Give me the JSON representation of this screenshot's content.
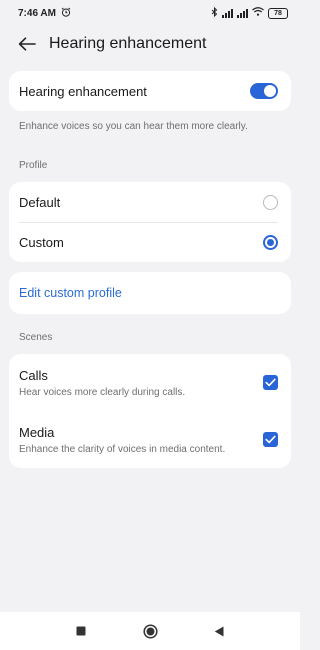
{
  "status_bar": {
    "time": "7:46 AM",
    "battery": "78",
    "icons": [
      "alarm-icon",
      "bluetooth-icon",
      "signal-icon",
      "signal-icon",
      "wifi-icon",
      "battery-icon"
    ]
  },
  "header": {
    "title": "Hearing enhancement",
    "back_icon": "back-arrow-icon"
  },
  "main_toggle": {
    "label": "Hearing enhancement",
    "enabled": true,
    "description": "Enhance voices so you can hear them more clearly."
  },
  "profile": {
    "section_label": "Profile",
    "options": [
      {
        "label": "Default",
        "selected": false
      },
      {
        "label": "Custom",
        "selected": true
      }
    ]
  },
  "edit_custom_profile": {
    "label": "Edit custom profile"
  },
  "scenes": {
    "section_label": "Scenes",
    "items": [
      {
        "title": "Calls",
        "subtitle": "Hear voices more clearly during calls.",
        "checked": true
      },
      {
        "title": "Media",
        "subtitle": "Enhance the clarity of voices in media content.",
        "checked": true
      }
    ]
  },
  "nav_bar": {
    "buttons": [
      "recents-square-icon",
      "home-circle-icon",
      "back-triangle-icon"
    ]
  },
  "colors": {
    "accent": "#2a65d8",
    "link": "#2b6bd6",
    "background": "#f2f2f5",
    "card": "#ffffff"
  }
}
